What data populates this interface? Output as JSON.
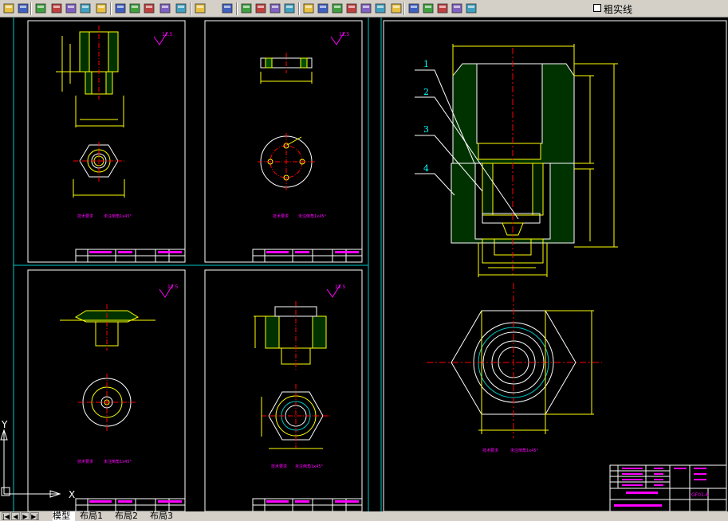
{
  "toolbar": {
    "buttons": [
      "new-icon",
      "open-icon",
      "save-icon",
      "print-icon",
      "plot-preview-icon",
      "publish-icon",
      "3d-dwf-icon",
      "cut-icon",
      "copy-icon",
      "paste-icon",
      "match-properties-icon",
      "block-editor-icon",
      "undo-icon",
      "redo-icon",
      "pan-icon",
      "zoom-realtime-icon",
      "zoom-window-icon",
      "zoom-previous-icon",
      "properties-icon",
      "design-center-icon",
      "tool-palettes-icon",
      "sheet-set-icon",
      "markup-icon",
      "quickcalc-icon",
      "help-icon",
      "layers-icon",
      "bulb-icon",
      "sun-icon",
      "freeze-icon",
      "lock-icon"
    ],
    "lineweight_label": "粗实线"
  },
  "ucs": {
    "y_label": "Y",
    "x_label": "X"
  },
  "sheets": {
    "roughness": "12.5",
    "chamfer_note": "未注倒角1x45°",
    "tech_label": "技术要求",
    "title_block_main": "GF01-6"
  },
  "balloons": [
    "1",
    "2",
    "3",
    "4"
  ],
  "tabs": {
    "items": [
      "模型",
      "布局1",
      "布局2",
      "布局3"
    ],
    "active": "模型"
  },
  "colors": {
    "background": "#000000",
    "frame": "#ffffff",
    "viewport": "#00c8c8",
    "geometry": "#ffff00",
    "hatch": "#00c800",
    "centerline": "#ff0000",
    "text": "#ff00ff",
    "dimension": "#ffff00",
    "leader": "#00ffff"
  }
}
